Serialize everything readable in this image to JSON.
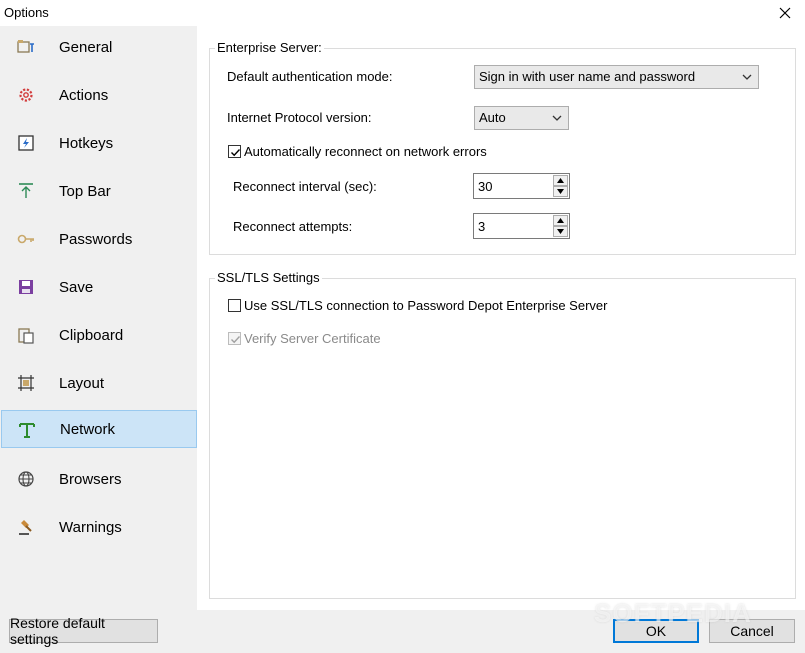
{
  "window": {
    "title": "Options"
  },
  "sidebar": {
    "items": [
      {
        "label": "General",
        "icon": "general-icon"
      },
      {
        "label": "Actions",
        "icon": "gear-icon"
      },
      {
        "label": "Hotkeys",
        "icon": "hotkey-icon"
      },
      {
        "label": "Top Bar",
        "icon": "top-bar-icon"
      },
      {
        "label": "Passwords",
        "icon": "key-icon"
      },
      {
        "label": "Save",
        "icon": "floppy-disk-icon"
      },
      {
        "label": "Clipboard",
        "icon": "clipboard-icon"
      },
      {
        "label": "Layout",
        "icon": "layout-icon"
      },
      {
        "label": "Network",
        "icon": "network-icon",
        "active": true
      },
      {
        "label": "Browsers",
        "icon": "globe-icon"
      },
      {
        "label": "Warnings",
        "icon": "gavel-icon"
      }
    ]
  },
  "enterprise": {
    "title": "Enterprise Server:",
    "auth_mode_label": "Default authentication mode:",
    "auth_mode_value": "Sign in with user name and password",
    "ip_version_label": "Internet Protocol version:",
    "ip_version_value": "Auto",
    "auto_reconnect_label": "Automatically reconnect on network errors",
    "auto_reconnect_checked": true,
    "interval_label": "Reconnect interval (sec):",
    "interval_value": "30",
    "attempts_label": "Reconnect attempts:",
    "attempts_value": "3"
  },
  "ssl": {
    "title": "SSL/TLS Settings",
    "use_ssl_label": "Use SSL/TLS connection to Password Depot Enterprise Server",
    "use_ssl_checked": false,
    "verify_label": "Verify Server Certificate",
    "verify_checked": true,
    "verify_disabled": true
  },
  "footer": {
    "restore_label": "Restore default settings",
    "ok_label": "OK",
    "cancel_label": "Cancel"
  },
  "watermark": "SOFTPEDIA",
  "colors": {
    "selected_bg": "#cce4f7",
    "accent": "#0078d7"
  }
}
